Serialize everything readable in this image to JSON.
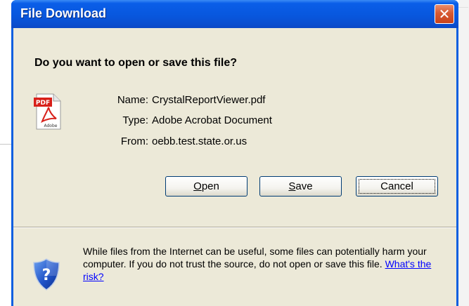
{
  "dialog": {
    "title": "File Download",
    "question": "Do you want to open or save this file?",
    "file": {
      "name_label": "Name:",
      "name_value": "CrystalReportViewer.pdf",
      "type_label": "Type:",
      "type_value": "Adobe Acrobat Document",
      "from_label": "From:",
      "from_value": "oebb.test.state.or.us",
      "icon": "pdf-file-icon",
      "icon_text": "PDF",
      "icon_brand": "Adobe"
    },
    "buttons": {
      "open": "Open",
      "open_key": "O",
      "open_rest": "pen",
      "save": "Save",
      "save_key": "S",
      "save_rest": "ave",
      "cancel": "Cancel"
    },
    "warning": {
      "text": "While files from the Internet can be useful, some files can potentially harm your computer. If you do not trust the source, do not open or save this file.",
      "link": "What's the risk?",
      "icon": "security-shield-icon",
      "icon_glyph": "?"
    },
    "close_glyph": "✕"
  },
  "colors": {
    "titlebar": "#0857de",
    "client_bg": "#ece9d8",
    "close_button": "#d75a33",
    "link": "#0000ff"
  }
}
